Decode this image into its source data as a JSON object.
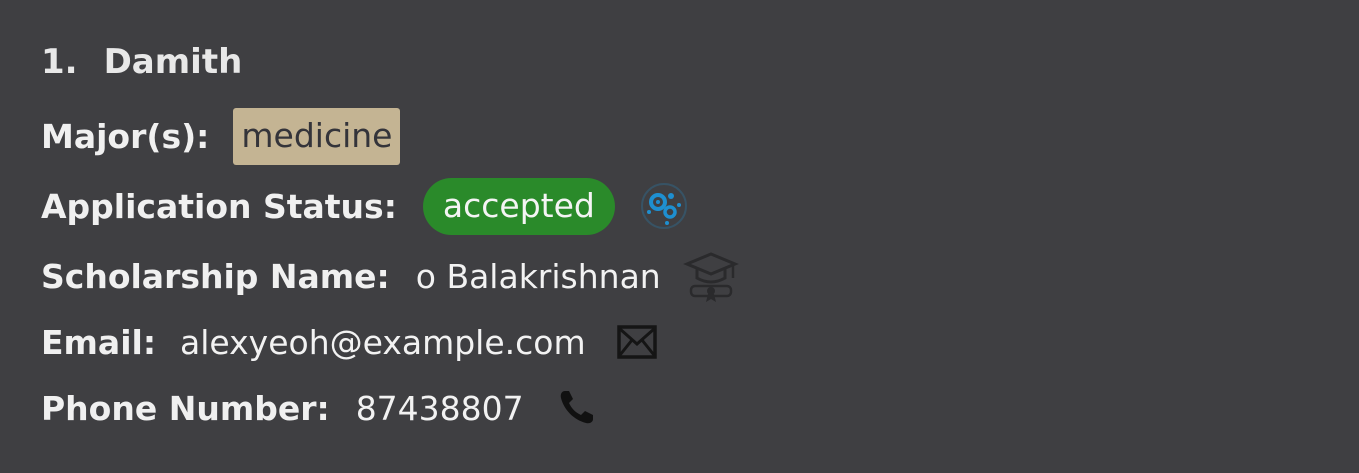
{
  "person": {
    "index": "1.",
    "name": "Damith"
  },
  "fields": {
    "major_label": "Major(s):",
    "major_value": "medicine",
    "status_label": "Application Status:",
    "status_value": "accepted",
    "scholarship_label": "Scholarship Name:",
    "scholarship_value": "o Balakrishnan",
    "email_label": "Email:",
    "email_value": "alexyeoh@example.com",
    "phone_label": "Phone Number:",
    "phone_value": "87438807"
  },
  "icons": {
    "status": "gears-icon",
    "scholarship": "graduation-cap-icon",
    "email": "envelope-icon",
    "phone": "phone-icon"
  },
  "colors": {
    "background": "#3f3f42",
    "major_tag": "#c4b493",
    "status_accepted": "#2a8a2a",
    "status_icon": "#1e8fd0"
  }
}
